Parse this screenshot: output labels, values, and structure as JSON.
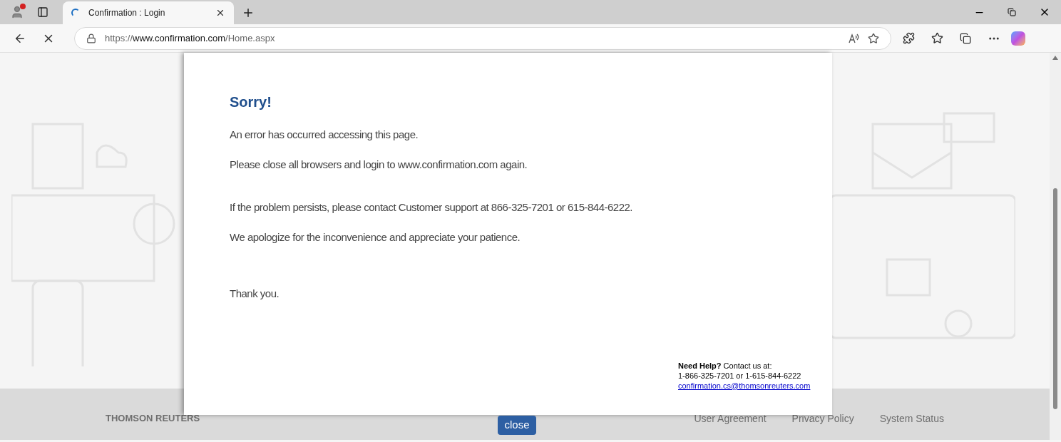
{
  "browser": {
    "tab": {
      "title": "Confirmation : Login",
      "selected": true
    },
    "address": {
      "scheme": "https://",
      "host": "www.confirmation.com",
      "path": "/Home.aspx"
    }
  },
  "dialog": {
    "heading": "Sorry!",
    "paragraphs": [
      "An error has occurred accessing this page.",
      "Please close all browsers and login to www.confirmation.com again.",
      "If the problem persists, please contact Customer support at 866-325-7201 or 615-844-6222.",
      "We apologize for the inconvenience and appreciate your patience.",
      "Thank you."
    ],
    "help": {
      "intro": "**Need Help?** Contact us at:",
      "phones": "1-866-325-7201 or 1-615-844-6222",
      "email": "confirmation.cs@thomsonreuters.com"
    },
    "close_button": "close"
  },
  "footer": {
    "brand": "THOMSON REUTERS",
    "links": [
      "User Agreement",
      "Privacy Policy",
      "System Status"
    ]
  }
}
